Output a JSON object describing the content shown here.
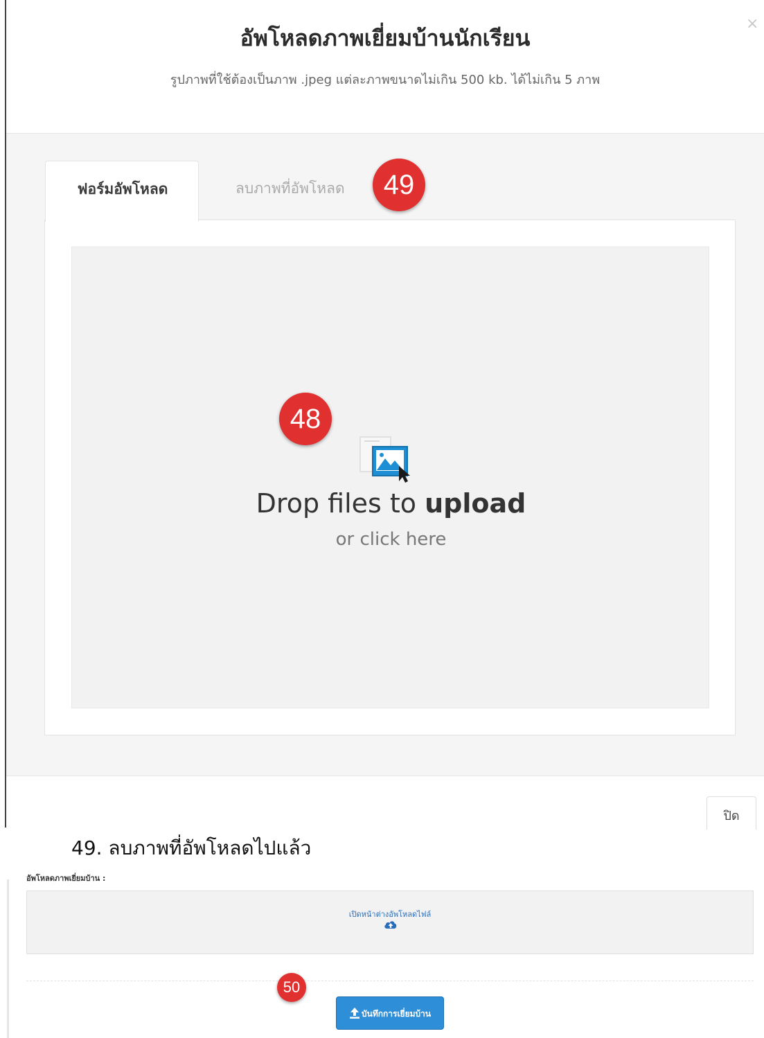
{
  "modal": {
    "title": "อัพโหลดภาพเยี่ยมบ้านนักเรียน",
    "subtitle": "รูปภาพที่ใช้ต้องเป็นภาพ .jpeg แต่ละภาพขนาดไม่เกิน 500 kb. ได้ไม่เกิน 5 ภาพ",
    "close_symbol": "×",
    "tabs": [
      {
        "label": "ฟอร์มอัพโหลด",
        "active": true
      },
      {
        "label": "ลบภาพที่อัพโหลด",
        "active": false
      }
    ],
    "dropzone": {
      "main_prefix": "Drop files to ",
      "main_bold": "upload",
      "sub": "or click here",
      "icon": "image-upload-icon"
    },
    "footer": {
      "close_label": "ปิด"
    }
  },
  "badges": {
    "b48": "48",
    "b49": "49",
    "b50": "50"
  },
  "caption": "49. ลบภาพที่อัพโหลดไปแล้ว",
  "form": {
    "label": "อัพโหลดภาพเยี่ยมบ้าน :",
    "open_window_label": "เปิดหน้าต่างอัพโหลดไฟล์",
    "open_icon": "cloud-upload-icon",
    "save_label": "บันทึกการเยี่ยมบ้าน",
    "save_icon": "upload-icon"
  },
  "colors": {
    "badge": "#e03030",
    "primary_button": "#2e8ed8",
    "link": "#2a6ebb"
  }
}
